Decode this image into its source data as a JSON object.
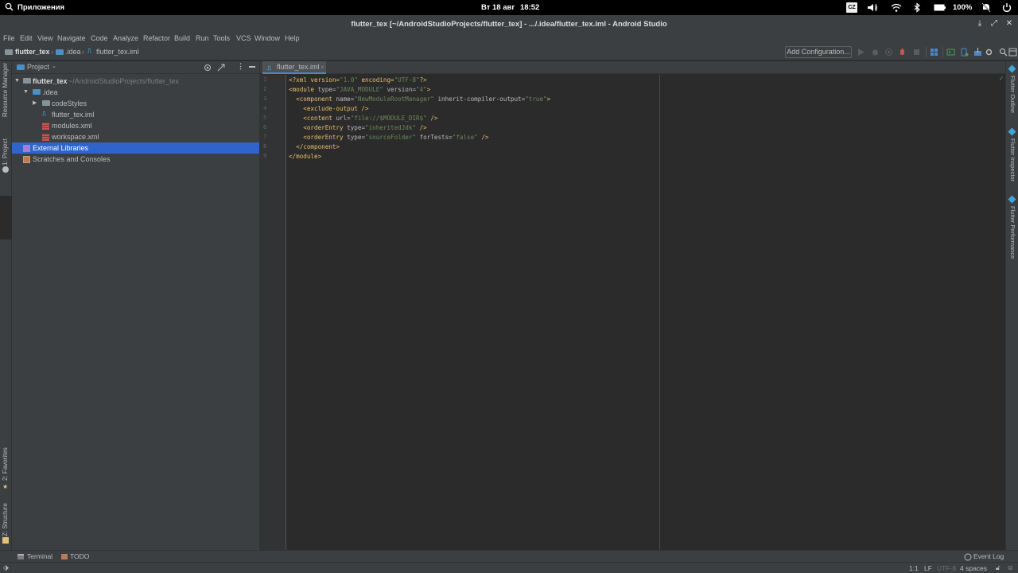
{
  "system_bar": {
    "apps_label": "Приложения",
    "date": "Вт 18 авг",
    "time": "18:52",
    "keyboard_layout": "CZ",
    "battery_percent": "100%"
  },
  "window": {
    "title": "flutter_tex [~/AndroidStudioProjects/flutter_tex] - .../.idea/flutter_tex.iml - Android Studio"
  },
  "menu": {
    "items": [
      "File",
      "Edit",
      "View",
      "Navigate",
      "Code",
      "Analyze",
      "Refactor",
      "Build",
      "Run",
      "Tools",
      "VCS",
      "Window",
      "Help"
    ]
  },
  "navbar": {
    "crumbs": [
      "flutter_tex",
      ".idea",
      "flutter_tex.iml"
    ],
    "add_configuration": "Add Configuration..."
  },
  "left_stripe": {
    "resource_manager": "Resource Manager",
    "project": "1: Project",
    "favorites": "2: Favorites",
    "structure": "Z: Structure"
  },
  "project_panel": {
    "header": "Project",
    "tree": {
      "root_name": "flutter_tex",
      "root_path": "~/AndroidStudioProjects/flutter_tex",
      "idea": ".idea",
      "codestyles": "codeStyles",
      "iml_file": "flutter_tex.iml",
      "modules_xml": "modules.xml",
      "workspace_xml": "workspace.xml",
      "external_libraries": "External Libraries",
      "scratches": "Scratches and Consoles"
    }
  },
  "editor": {
    "tab_label": "flutter_tex.iml",
    "lines": [
      {
        "num": "1"
      },
      {
        "num": "2"
      },
      {
        "num": "3"
      },
      {
        "num": "4"
      },
      {
        "num": "5"
      },
      {
        "num": "6"
      },
      {
        "num": "7"
      },
      {
        "num": "8"
      },
      {
        "num": "9"
      }
    ],
    "code": {
      "l1_a": "<?xml version=",
      "l1_b": "\"1.0\"",
      "l1_c": " encoding=",
      "l1_d": "\"UTF-8\"",
      "l1_e": "?>",
      "l2_tag": "<module ",
      "l2_a1": "type=",
      "l2_v1": "\"JAVA_MODULE\"",
      "l2_a2": " version=",
      "l2_v2": "\"4\"",
      "l2_end": ">",
      "l3_tag": "  <component ",
      "l3_a1": "name=",
      "l3_v1": "\"NewModuleRootManager\"",
      "l3_a2": " inherit-compiler-output=",
      "l3_v2": "\"true\"",
      "l3_end": ">",
      "l4": "    <exclude-output />",
      "l5_tag": "    <content ",
      "l5_a1": "url=",
      "l5_v1": "\"file://$MODULE_DIR$\"",
      "l5_end": " />",
      "l6_tag": "    <orderEntry ",
      "l6_a1": "type=",
      "l6_v1": "\"inheritedJdk\"",
      "l6_end": " />",
      "l7_tag": "    <orderEntry ",
      "l7_a1": "type=",
      "l7_v1": "\"sourceFolder\"",
      "l7_a2": " forTests=",
      "l7_v2": "\"false\"",
      "l7_end": " />",
      "l8": "  </component>",
      "l9": "</module>"
    }
  },
  "right_stripe": {
    "outline": "Flutter Outline",
    "inspector": "Flutter Inspector",
    "performance": "Flutter Performance"
  },
  "bottom_tools": {
    "terminal": "Terminal",
    "todo": "TODO",
    "event_log": "Event Log"
  },
  "status": {
    "position": "1:1",
    "line_sep": "LF",
    "encoding": "UTF-8",
    "indent": "4 spaces"
  }
}
